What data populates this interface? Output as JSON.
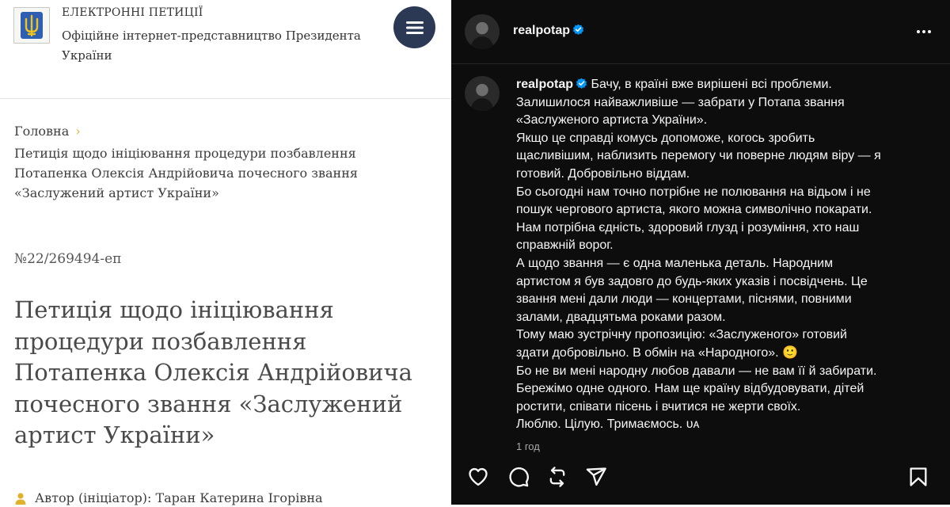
{
  "petition_site": {
    "header": {
      "kicker": "ЕЛЕКТРОННІ ПЕТИЦІЇ",
      "subtitle": "Офіційне інтернет-представництво Президента України",
      "menu_icon": "hamburger-icon",
      "logo_icon": "trident-emblem"
    },
    "breadcrumb": {
      "home": "Головна",
      "separator": "›",
      "current": "Петиція щодо ініціювання процедури позбавлення Потапенка Олексія Андрійовича почесного звання «Заслужений артист України»"
    },
    "petition_number": "№22/269494-еп",
    "petition_title": "Петиція щодо ініціювання процедури позбавлення Потапенка Олексія Андрійовича почесного звання «Заслужений артист України»",
    "author": "Автор (ініціатор): Таран Катерина Ігорівна",
    "colors": {
      "menu_button": "#2b3955",
      "accent": "#e0b12a",
      "text": "#3a3a3a"
    }
  },
  "instagram_post": {
    "username": "realpotap",
    "verified": true,
    "caption_lines": [
      "Бачу, в країні вже вирішені всі проблеми.",
      "Залишилося найважливіше — забрати у Потапа звання",
      "«Заслуженого артиста України».",
      "Якщо це справді комусь допоможе, когось зробить",
      "щасливішим, наблизить перемогу чи поверне людям віру — я",
      "готовий. Добровільно віддам.",
      "Бо сьогодні нам точно потрібне не полювання на відьом і не",
      "пошук чергового артиста, якого можна символічно покарати.",
      "Нам потрібна єдність, здоровий глузд і розуміння, хто наш",
      "справжній ворог.",
      "А щодо звання — є одна маленька деталь. Народним",
      "артистом я був задовго до будь-яких указів і посвідчень. Це",
      "звання мені дали люди — концертами, піснями, повними",
      "залами, двадцятьма роками разом.",
      "Тому маю зустрічну пропозицію: «Заслуженого» готовий",
      "здати добровільно. В обмін на «Народного». 🙂",
      "Бо не ви мені народну любов давали — не вам її й забирати.",
      "Бережімо одне одного. Нам ще країну відбудовувати, дітей",
      "ростити, співати пісень і вчитися не жерти своїх.",
      "Люблю. Цілую. Тримаємось. ᴜᴀ"
    ],
    "time": "1 год",
    "icons": {
      "more": "more-icon",
      "like": "heart-icon",
      "comment": "comment-icon",
      "repost": "repost-icon",
      "share": "share-icon",
      "save": "bookmark-icon"
    },
    "colors": {
      "background": "#0d0d0d",
      "verified": "#0095f6",
      "muted": "#a8a8a8"
    }
  }
}
